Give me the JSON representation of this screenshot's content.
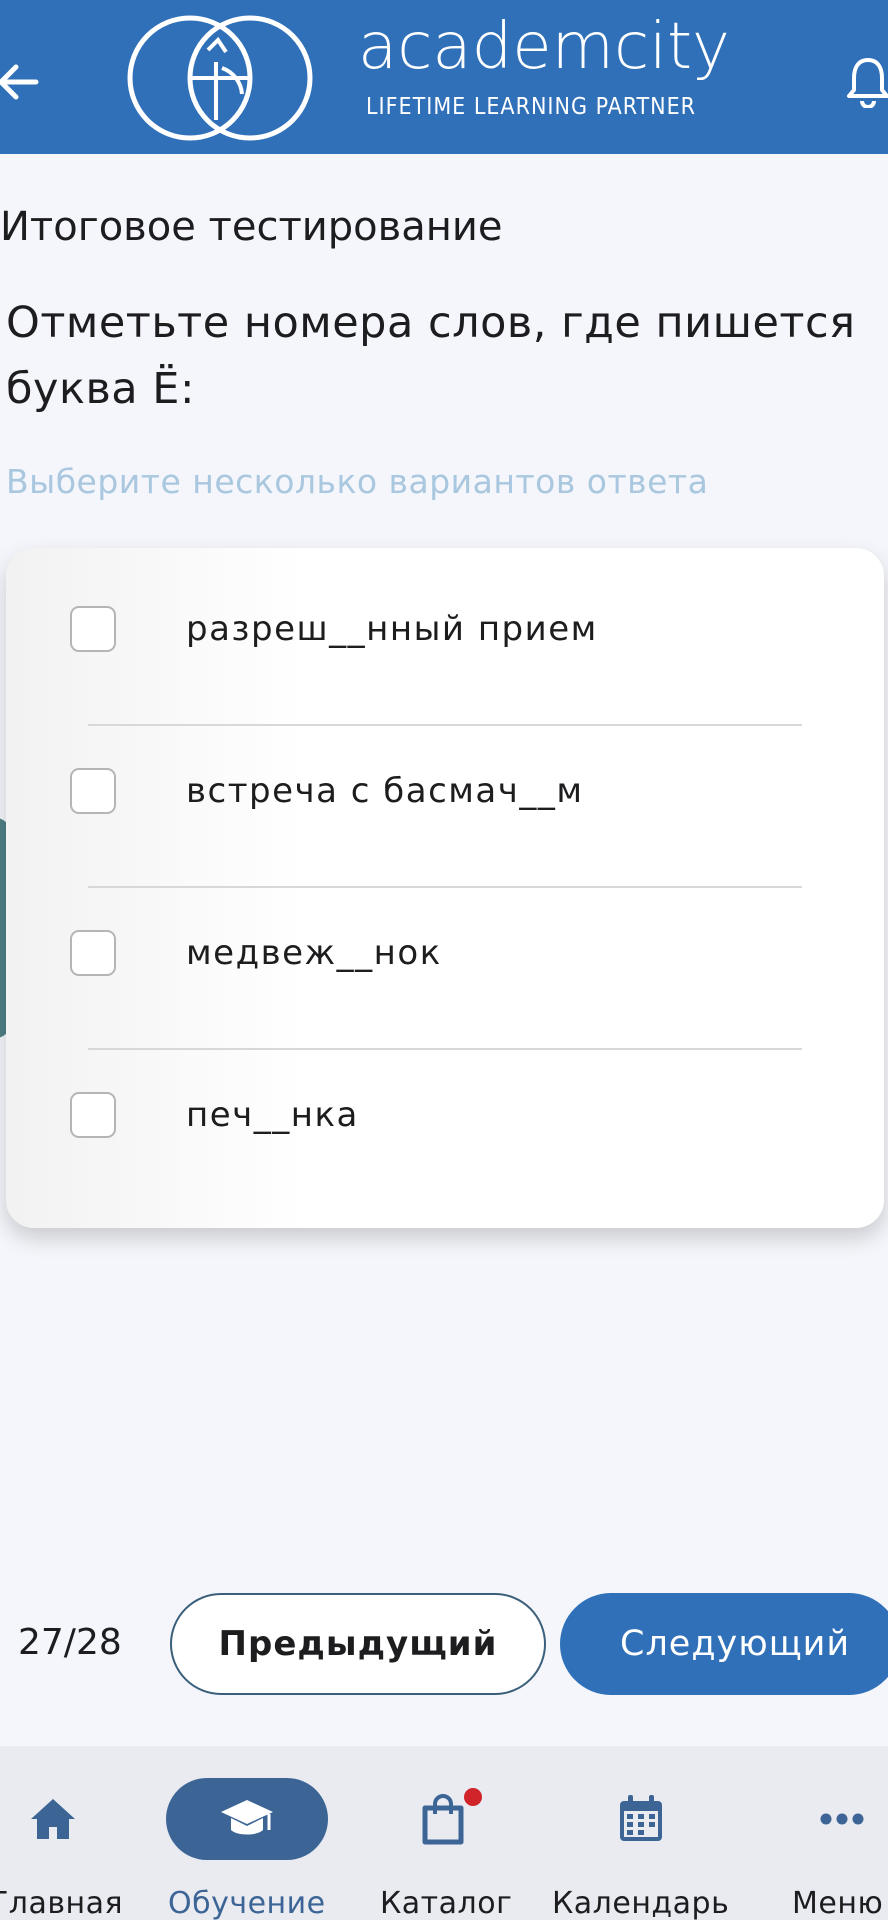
{
  "header": {
    "brand": "academcity",
    "tagline": "LIFETIME LEARNING PARTNER",
    "back_icon": "arrow-left-icon",
    "notification_icon": "bell-icon",
    "background_color": "#2f70b8"
  },
  "test": {
    "title": "Итоговое тестирование",
    "question": "Отметьте номера слов, где пишется буква Ё:",
    "hint": "Выберите несколько вариантов ответа",
    "options": [
      {
        "label": "разреш__нный прием",
        "checked": false
      },
      {
        "label": "встреча с басмач__м",
        "checked": false
      },
      {
        "label": "медвеж__нок",
        "checked": false
      },
      {
        "label": "печ__нка",
        "checked": false
      }
    ]
  },
  "navigation": {
    "progress": "27/28",
    "prev_label": "Предыдущий",
    "next_label": "Следующий"
  },
  "tabbar": {
    "items": [
      {
        "label": "Главная",
        "icon": "home-icon",
        "active": false
      },
      {
        "label": "Обучение",
        "icon": "graduation-cap-icon",
        "active": true
      },
      {
        "label": "Каталог",
        "icon": "shopping-bag-icon",
        "active": false,
        "badge": true
      },
      {
        "label": "Календарь",
        "icon": "calendar-icon",
        "active": false
      },
      {
        "label": "Меню",
        "icon": "more-dots-icon",
        "active": false
      }
    ],
    "active_color": "#3c6596",
    "badge_color": "#d0232a"
  }
}
